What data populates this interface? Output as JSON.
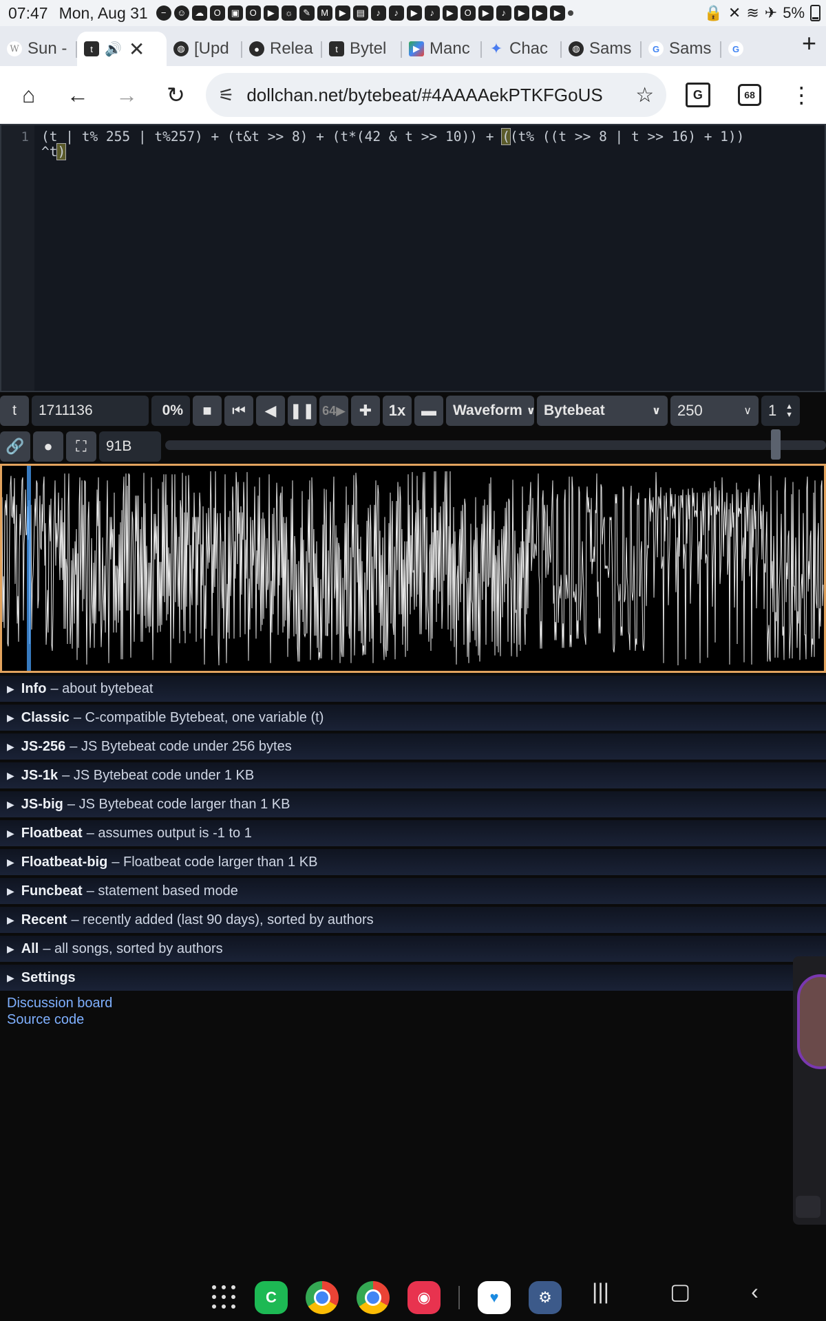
{
  "status_bar": {
    "time": "07:47",
    "date": "Mon, Aug 31",
    "battery": "5%"
  },
  "tabs": [
    {
      "label": "Sun -",
      "icon": "wikipedia-icon"
    },
    {
      "label": "",
      "icon": "dollchan-icon",
      "active": true
    },
    {
      "label": "[Upd",
      "icon": "globe-icon"
    },
    {
      "label": "Relea",
      "icon": "github-icon"
    },
    {
      "label": "Bytel",
      "icon": "dollchan-icon"
    },
    {
      "label": "Manc",
      "icon": "play-store-icon"
    },
    {
      "label": "Chac",
      "icon": "gemini-icon"
    },
    {
      "label": "Sams",
      "icon": "globe-icon"
    },
    {
      "label": "Sams",
      "icon": "google-icon"
    },
    {
      "label": "",
      "icon": "google-icon"
    }
  ],
  "toolbar": {
    "url": "dollchan.net/bytebeat/#4AAAAekPTKFGoUS",
    "tab_count": "68"
  },
  "editor": {
    "line_number": "1",
    "code_before": "(t | t% 255 | t%257) + (t&t >> 8) + (t*(42 & t >> 10)) + ",
    "code_hl_open": "(",
    "code_mid": "(t% ((t >> 8 | t >> 16) + 1))\n^t",
    "code_hl_close": ")"
  },
  "controls": {
    "t_label": "t",
    "time_value": "1711136",
    "percent": "0%",
    "speed_64": "64▶",
    "playback_rate": "1x",
    "view_mode": "Waveform",
    "mode": "Bytebeat",
    "sample_rate": "250",
    "divisor": "1",
    "code_size": "91B"
  },
  "sections": [
    {
      "title": "Info",
      "desc": "– about bytebeat"
    },
    {
      "title": "Classic",
      "desc": "– C-compatible Bytebeat, one variable (t)"
    },
    {
      "title": "JS-256",
      "desc": "– JS Bytebeat code under 256 bytes"
    },
    {
      "title": "JS-1k",
      "desc": "– JS Bytebeat code under 1 KB"
    },
    {
      "title": "JS-big",
      "desc": "– JS Bytebeat code larger than 1 KB"
    },
    {
      "title": "Floatbeat",
      "desc": "– assumes output is -1 to 1"
    },
    {
      "title": "Floatbeat-big",
      "desc": "– Floatbeat code larger than 1 KB"
    },
    {
      "title": "Funcbeat",
      "desc": "– statement based mode"
    },
    {
      "title": "Recent",
      "desc": "– recently added (last 90 days), sorted by authors"
    },
    {
      "title": "All",
      "desc": "– all songs, sorted by authors"
    },
    {
      "title": "Settings",
      "desc": ""
    }
  ],
  "links": {
    "discussion": "Discussion board",
    "source": "Source code"
  },
  "colors": {
    "waveform_border": "#e2a35e",
    "cursor": "#4aa3ff",
    "link": "#7fb0ff"
  }
}
